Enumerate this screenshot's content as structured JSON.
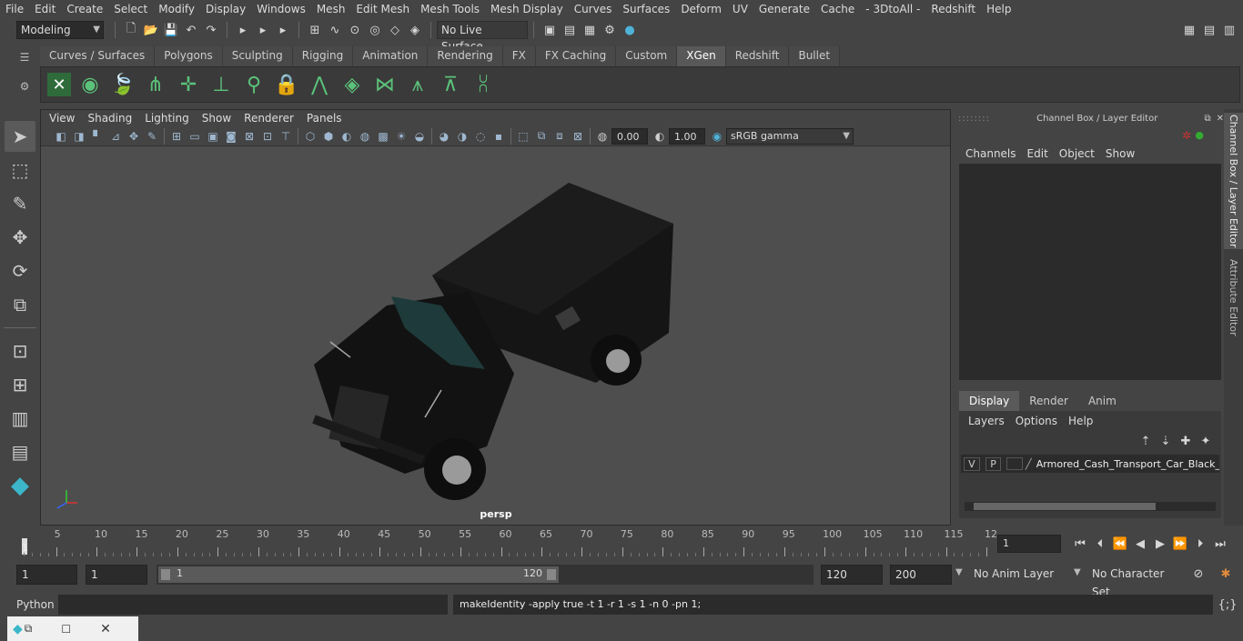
{
  "menubar": {
    "items": [
      "File",
      "Edit",
      "Create",
      "Select",
      "Modify",
      "Display",
      "Windows",
      "Mesh",
      "Edit Mesh",
      "Mesh Tools",
      "Mesh Display",
      "Curves",
      "Surfaces",
      "Deform",
      "UV",
      "Generate",
      "Cache",
      "- 3DtoAll -",
      "Redshift",
      "Help"
    ]
  },
  "statusline": {
    "mode": "Modeling",
    "live_surface": "No Live Surface"
  },
  "shelf": {
    "tabs": [
      "Curves / Surfaces",
      "Polygons",
      "Sculpting",
      "Rigging",
      "Animation",
      "Rendering",
      "FX",
      "FX Caching",
      "Custom",
      "XGen",
      "Redshift",
      "Bullet"
    ],
    "active_tab": "XGen"
  },
  "viewport": {
    "menu": [
      "View",
      "Shading",
      "Lighting",
      "Show",
      "Renderer",
      "Panels"
    ],
    "exposure": "0.00",
    "gamma": "1.00",
    "color_space": "sRGB gamma",
    "camera": "persp"
  },
  "channel_box": {
    "title": "Channel Box / Layer Editor",
    "menu": [
      "Channels",
      "Edit",
      "Object",
      "Show"
    ],
    "layer_tabs": [
      "Display",
      "Render",
      "Anim"
    ],
    "layer_menu": [
      "Layers",
      "Options",
      "Help"
    ],
    "layer": {
      "v": "V",
      "p": "P",
      "name": "Armored_Cash_Transport_Car_Black_l"
    }
  },
  "side_tabs": {
    "channel_box": "Channel Box / Layer Editor",
    "attribute_editor": "Attribute Editor"
  },
  "timeline": {
    "ticks": [
      "5",
      "10",
      "15",
      "20",
      "25",
      "30",
      "35",
      "40",
      "45",
      "50",
      "55",
      "60",
      "65",
      "70",
      "75",
      "80",
      "85",
      "90",
      "95",
      "100",
      "105",
      "110",
      "115",
      "12"
    ],
    "start_label": "1",
    "current_frame": "1"
  },
  "range": {
    "start": "1",
    "start2": "1",
    "slider_start": "1",
    "slider_end": "120",
    "end": "120",
    "end2": "200",
    "anim_layer": "No Anim Layer",
    "character_set": "No Character Set"
  },
  "command": {
    "lang": "Python",
    "feedback": "makeIdentity -apply true -t 1 -r 1 -s 1 -n 0 -pn 1;"
  },
  "colors": {
    "accent": "#5285a6",
    "shelf_icon": "#5bc27a",
    "bg": "#444444"
  }
}
